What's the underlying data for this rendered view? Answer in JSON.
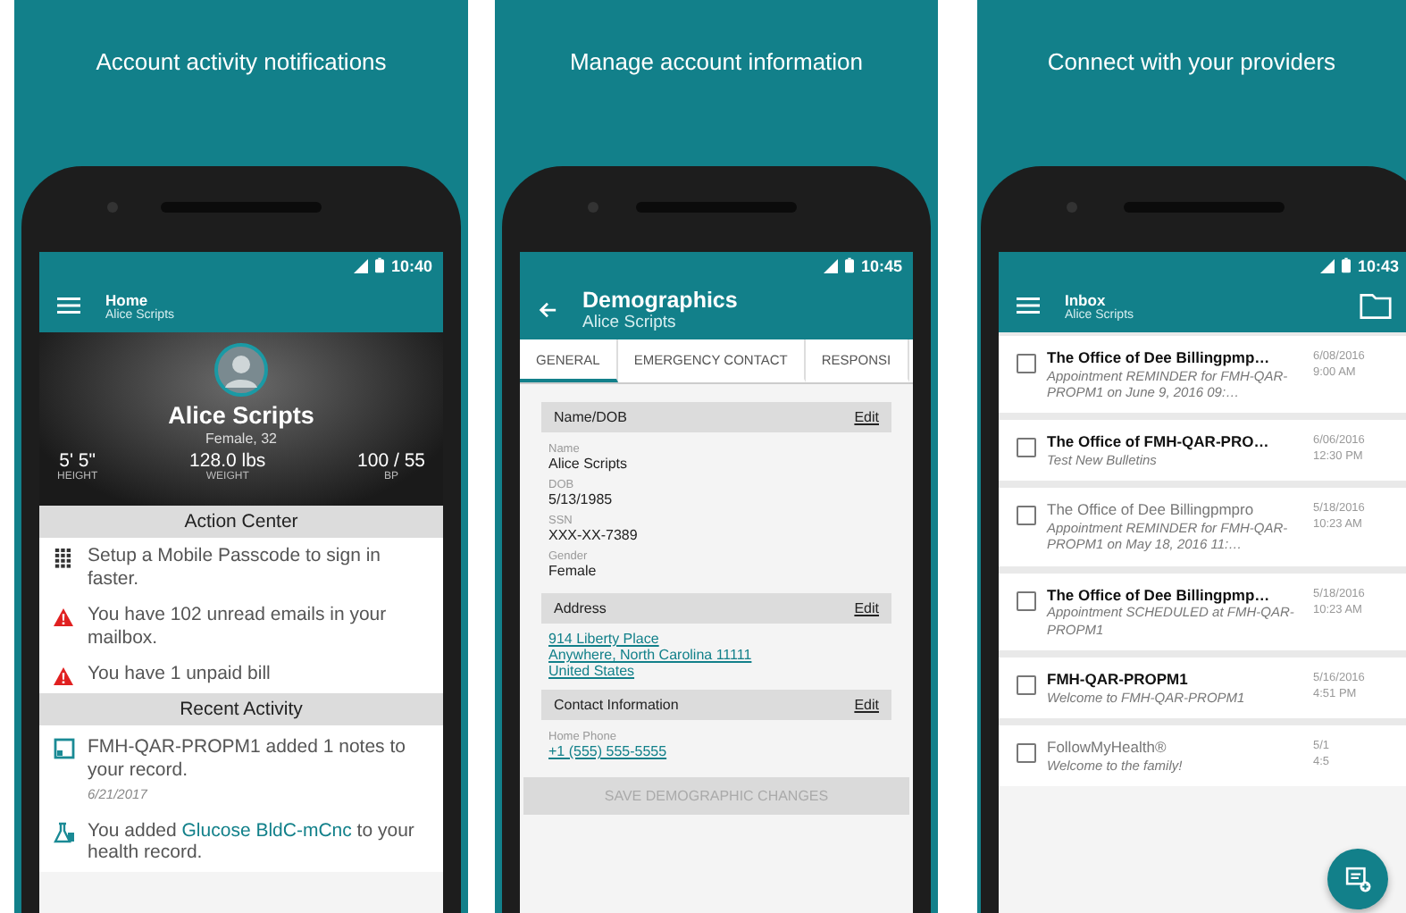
{
  "panels": [
    {
      "kind": "home",
      "caption": "Account activity notifications",
      "time": "10:40",
      "title": "Home",
      "subtitle": "Alice Scripts",
      "profile": {
        "name": "Alice Scripts",
        "details": "Female, 32",
        "stats": [
          {
            "value": "5' 5\"",
            "label": "HEIGHT"
          },
          {
            "value": "128.0 lbs",
            "label": "WEIGHT"
          },
          {
            "value": "100 / 55",
            "label": "BP"
          }
        ]
      },
      "action_center": {
        "heading": "Action Center",
        "items": [
          {
            "kind": "passcode",
            "text": "Setup a Mobile Passcode to sign in faster."
          },
          {
            "kind": "alert",
            "text": "You have 102 unread emails in your mailbox."
          },
          {
            "kind": "alert",
            "text": "You have 1 unpaid bill"
          }
        ]
      },
      "recent_activity": {
        "heading": "Recent Activity",
        "items": [
          {
            "kind": "note",
            "text": "FMH-QAR-PROPM1 added 1 notes to your record.",
            "date": "6/21/2017"
          },
          {
            "kind": "lab",
            "text": "You added ",
            "link": "Glucose BldC-mCnc",
            "text_after": " to your health record."
          }
        ]
      }
    },
    {
      "kind": "demographics",
      "caption": "Manage account information",
      "time": "10:45",
      "title": "Demographics",
      "subtitle": "Alice Scripts",
      "tabs": [
        {
          "label": "GENERAL",
          "selected": true
        },
        {
          "label": "EMERGENCY CONTACT",
          "selected": false
        },
        {
          "label": "RESPONSI",
          "selected": false
        }
      ],
      "sections": [
        {
          "title": "Name/DOB",
          "action": "Edit",
          "fields": [
            {
              "kind": "text",
              "label": "Name",
              "value": "Alice Scripts"
            },
            {
              "kind": "text",
              "label": "DOB",
              "value": "5/13/1985"
            },
            {
              "kind": "text",
              "label": "SSN",
              "value": "XXX-XX-7389"
            },
            {
              "kind": "text",
              "label": "Gender",
              "value": "Female"
            }
          ]
        },
        {
          "title": "Address",
          "action": "Edit",
          "fields": [
            {
              "kind": "link",
              "value": "914 Liberty Place"
            },
            {
              "kind": "link",
              "value": "Anywhere, North Carolina 11111"
            },
            {
              "kind": "link",
              "value": "United States"
            }
          ]
        },
        {
          "title": "Contact Information",
          "action": "Edit",
          "fields": [
            {
              "kind": "link",
              "label": "Home Phone",
              "value": "+1 (555) 555-5555"
            }
          ]
        }
      ],
      "save_button": {
        "label": "SAVE DEMOGRAPHIC CHANGES",
        "disabled": true
      }
    },
    {
      "kind": "inbox",
      "caption": "Connect with your providers",
      "time": "10:43",
      "title": "Inbox",
      "subtitle": "Alice Scripts",
      "messages": [
        {
          "sender": "The Office of Dee Billingpmp…",
          "preview": "Appointment REMINDER for FMH-QAR-PROPM1 on June 9, 2016 09:…",
          "date": "6/08/2016",
          "time": "9:00 AM",
          "unread": true,
          "checked": false
        },
        {
          "sender": "The Office of FMH-QAR-PRO…",
          "preview": "Test New Bulletins",
          "date": "6/06/2016",
          "time": "12:30 PM",
          "unread": true,
          "checked": false
        },
        {
          "sender": "The Office of Dee Billingpmpro",
          "preview": "Appointment REMINDER for FMH-QAR-PROPM1 on May 18, 2016 11:…",
          "date": "5/18/2016",
          "time": "10:23 AM",
          "unread": false,
          "checked": false
        },
        {
          "sender": "The Office of Dee Billingpmp…",
          "preview": "Appointment SCHEDULED at FMH-QAR-PROPM1",
          "date": "5/18/2016",
          "time": "10:23 AM",
          "unread": true,
          "checked": false
        },
        {
          "sender": "FMH-QAR-PROPM1",
          "preview": "Welcome to FMH-QAR-PROPM1",
          "date": "5/16/2016",
          "time": "4:51 PM",
          "unread": true,
          "checked": false
        },
        {
          "sender": "FollowMyHealth®",
          "preview": "Welcome to the family!",
          "date": "5/1",
          "time": "4:5",
          "unread": false,
          "checked": false
        }
      ]
    }
  ]
}
